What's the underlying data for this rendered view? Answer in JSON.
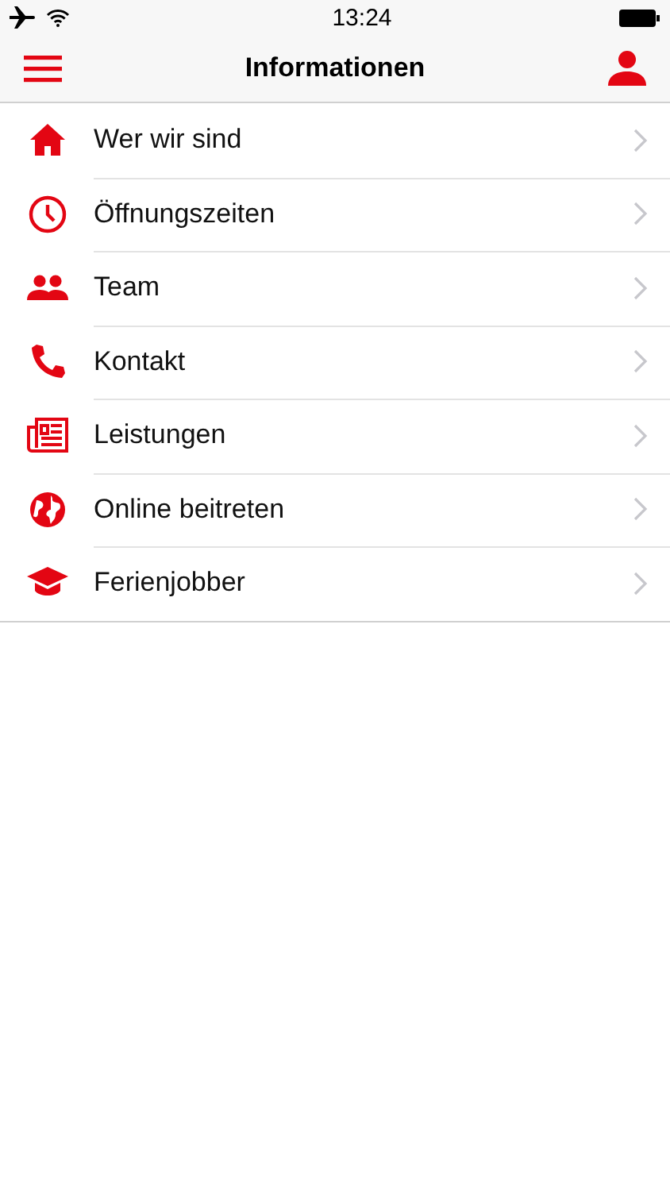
{
  "status_bar": {
    "time": "13:24"
  },
  "nav_bar": {
    "title": "Informationen"
  },
  "items": [
    {
      "label": "Wer wir sind",
      "kind": "home"
    },
    {
      "label": "Öffnungszeiten",
      "kind": "clock"
    },
    {
      "label": "Team",
      "kind": "people"
    },
    {
      "label": "Kontakt",
      "kind": "phone"
    },
    {
      "label": "Leistungen",
      "kind": "newspaper"
    },
    {
      "label": "Online beitreten",
      "kind": "globe"
    },
    {
      "label": "Ferienjobber",
      "kind": "cap"
    }
  ]
}
